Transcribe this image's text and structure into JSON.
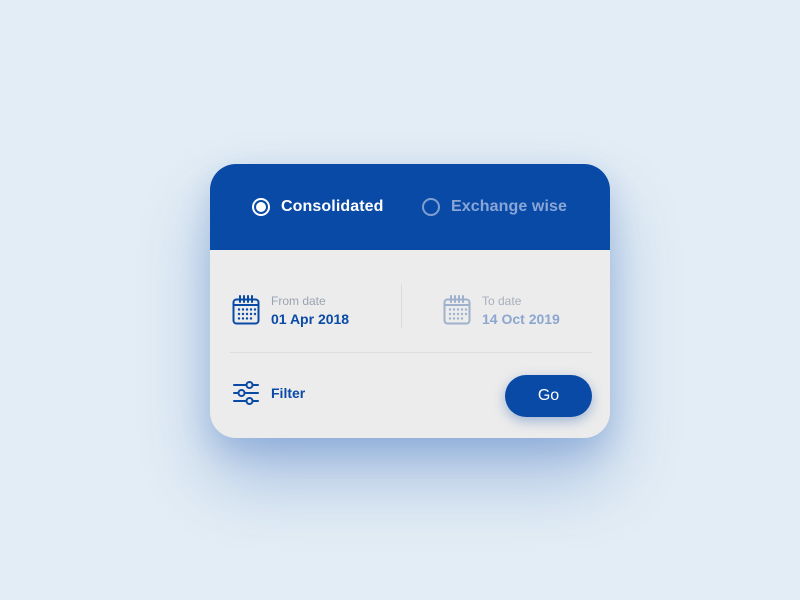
{
  "view_mode": {
    "options": [
      {
        "label": "Consolidated",
        "selected": true
      },
      {
        "label": "Exchange wise",
        "selected": false
      }
    ]
  },
  "date_range": {
    "from": {
      "caption": "From date",
      "value": "01 Apr 2018",
      "icon": "calendar-icon"
    },
    "to": {
      "caption": "To date",
      "value": "14 Oct 2019",
      "icon": "calendar-icon"
    }
  },
  "filter": {
    "label": "Filter",
    "icon": "sliders-icon"
  },
  "go_button": {
    "label": "Go"
  },
  "colors": {
    "background": "#e3edf5",
    "primary": "#0a4aa7",
    "card": "#ececec",
    "muted_blue": "#89a6d6",
    "caption_gray": "#9aa3b2"
  }
}
